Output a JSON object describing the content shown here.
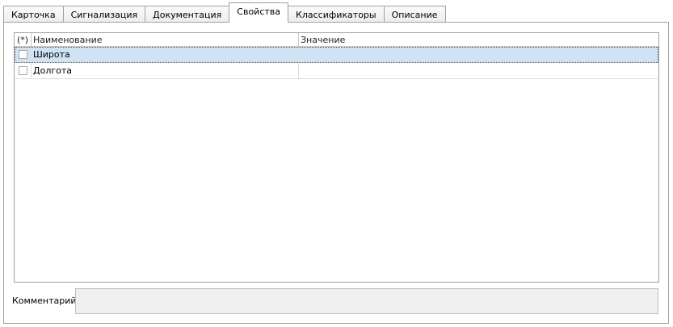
{
  "tabs": [
    {
      "label": "Карточка",
      "active": false
    },
    {
      "label": "Сигнализация",
      "active": false
    },
    {
      "label": "Документация",
      "active": false
    },
    {
      "label": "Свойства",
      "active": true
    },
    {
      "label": "Классификаторы",
      "active": false
    },
    {
      "label": "Описание",
      "active": false
    }
  ],
  "grid": {
    "columns": [
      "(*)",
      "Наименование",
      "Значение"
    ],
    "rows": [
      {
        "name": "Широта",
        "value": "",
        "checked": false,
        "selected": true
      },
      {
        "name": "Долгота",
        "value": "",
        "checked": false,
        "selected": false
      }
    ]
  },
  "comment": {
    "label": "Комментарий:",
    "value": ""
  },
  "colors": {
    "selection": "#cfe3f4",
    "border": "#a0a0a0",
    "comment_bg": "#efefef"
  }
}
